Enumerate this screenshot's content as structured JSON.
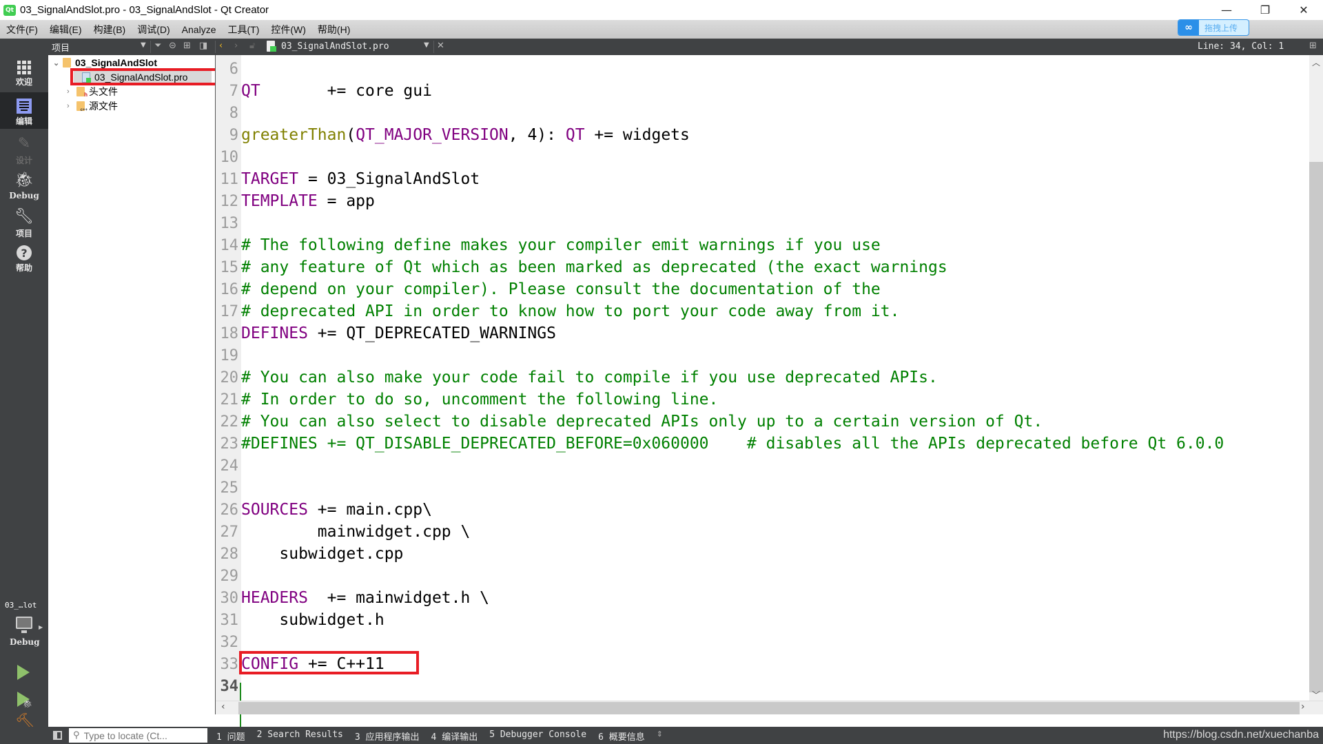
{
  "window": {
    "title": "03_SignalAndSlot.pro - 03_SignalAndSlot - Qt Creator",
    "app_icon_text": "Qt",
    "minimize": "—",
    "restore": "❐",
    "close": "✕"
  },
  "menu": [
    {
      "label": "文件(F)"
    },
    {
      "label": "编辑(E)"
    },
    {
      "label": "构建(B)"
    },
    {
      "label": "调试(D)"
    },
    {
      "label": "Analyze"
    },
    {
      "label": "工具(T)"
    },
    {
      "label": "控件(W)"
    },
    {
      "label": "帮助(H)"
    }
  ],
  "cloud_upload": {
    "label": "拖拽上传",
    "icon": "cloud-icon"
  },
  "toolbar": {
    "project_view": "项目",
    "open_file": "03_SignalAndSlot.pro",
    "line_col": "Line: 34, Col: 1"
  },
  "modes": [
    {
      "label": "欢迎",
      "icon": "grid-icon",
      "state": "normal"
    },
    {
      "label": "编辑",
      "icon": "edit-icon",
      "state": "active"
    },
    {
      "label": "设计",
      "icon": "pencil-icon",
      "state": "disabled"
    },
    {
      "label": "Debug",
      "icon": "bug-icon",
      "state": "normal"
    },
    {
      "label": "项目",
      "icon": "wrench-icon",
      "state": "normal"
    },
    {
      "label": "帮助",
      "icon": "help-icon",
      "state": "normal"
    }
  ],
  "kit": {
    "project": "03_…lot",
    "build": "Debug"
  },
  "tree": {
    "root": "03_SignalAndSlot",
    "items": [
      {
        "label": "03_SignalAndSlot.pro",
        "type": "pro",
        "selected": true
      },
      {
        "label": "头文件",
        "type": "folder",
        "badge": "h"
      },
      {
        "label": "源文件",
        "type": "folder",
        "badge": "c++"
      }
    ]
  },
  "editor": {
    "current_line": 34,
    "lines": [
      {
        "n": "6",
        "tokens": []
      },
      {
        "n": "7",
        "tokens": [
          {
            "t": "QT",
            "c": "kw"
          },
          {
            "t": "       += core gui",
            "c": "code"
          }
        ]
      },
      {
        "n": "8",
        "tokens": []
      },
      {
        "n": "9",
        "tokens": [
          {
            "t": "greaterThan",
            "c": "fn"
          },
          {
            "t": "(",
            "c": "code"
          },
          {
            "t": "QT_MAJOR_VERSION",
            "c": "kw"
          },
          {
            "t": ", 4): ",
            "c": "code"
          },
          {
            "t": "QT",
            "c": "kw"
          },
          {
            "t": " += widgets",
            "c": "code"
          }
        ]
      },
      {
        "n": "10",
        "tokens": []
      },
      {
        "n": "11",
        "tokens": [
          {
            "t": "TARGET",
            "c": "kw"
          },
          {
            "t": " = 03_SignalAndSlot",
            "c": "code"
          }
        ]
      },
      {
        "n": "12",
        "tokens": [
          {
            "t": "TEMPLATE",
            "c": "kw"
          },
          {
            "t": " = app",
            "c": "code"
          }
        ]
      },
      {
        "n": "13",
        "tokens": []
      },
      {
        "n": "14",
        "tokens": [
          {
            "t": "# The following define makes your compiler emit warnings if you use",
            "c": "cm"
          }
        ]
      },
      {
        "n": "15",
        "tokens": [
          {
            "t": "# any feature of Qt which as been marked as deprecated (the exact warnings",
            "c": "cm"
          }
        ]
      },
      {
        "n": "16",
        "tokens": [
          {
            "t": "# depend on your compiler). Please consult the documentation of the",
            "c": "cm"
          }
        ]
      },
      {
        "n": "17",
        "tokens": [
          {
            "t": "# deprecated API in order to know how to port your code away from it.",
            "c": "cm"
          }
        ]
      },
      {
        "n": "18",
        "tokens": [
          {
            "t": "DEFINES",
            "c": "kw"
          },
          {
            "t": " += QT_DEPRECATED_WARNINGS",
            "c": "code"
          }
        ]
      },
      {
        "n": "19",
        "tokens": []
      },
      {
        "n": "20",
        "tokens": [
          {
            "t": "# You can also make your code fail to compile if you use deprecated APIs.",
            "c": "cm"
          }
        ]
      },
      {
        "n": "21",
        "tokens": [
          {
            "t": "# In order to do so, uncomment the following line.",
            "c": "cm"
          }
        ]
      },
      {
        "n": "22",
        "tokens": [
          {
            "t": "# You can also select to disable deprecated APIs only up to a certain version of Qt.",
            "c": "cm"
          }
        ]
      },
      {
        "n": "23",
        "tokens": [
          {
            "t": "#DEFINES += QT_DISABLE_DEPRECATED_BEFORE=0x060000    # disables all the APIs deprecated before Qt 6.0.0",
            "c": "cm"
          }
        ]
      },
      {
        "n": "24",
        "tokens": []
      },
      {
        "n": "25",
        "tokens": []
      },
      {
        "n": "26",
        "tokens": [
          {
            "t": "SOURCES",
            "c": "kw"
          },
          {
            "t": " += main.cpp\\",
            "c": "code"
          }
        ]
      },
      {
        "n": "27",
        "tokens": [
          {
            "t": "        mainwidget.cpp \\",
            "c": "code"
          }
        ]
      },
      {
        "n": "28",
        "tokens": [
          {
            "t": "    subwidget.cpp",
            "c": "code"
          }
        ]
      },
      {
        "n": "29",
        "tokens": []
      },
      {
        "n": "30",
        "tokens": [
          {
            "t": "HEADERS",
            "c": "kw"
          },
          {
            "t": "  += mainwidget.h \\",
            "c": "code"
          }
        ]
      },
      {
        "n": "31",
        "tokens": [
          {
            "t": "    subwidget.h",
            "c": "code"
          }
        ]
      },
      {
        "n": "32",
        "tokens": []
      },
      {
        "n": "33",
        "tokens": [
          {
            "t": "CONFIG",
            "c": "kw"
          },
          {
            "t": " += C++11",
            "c": "code"
          }
        ]
      },
      {
        "n": "34",
        "tokens": []
      }
    ]
  },
  "locator": {
    "placeholder": "Type to locate (Ct..."
  },
  "output_tabs": [
    {
      "label": "1 问题"
    },
    {
      "label": "2 Search Results"
    },
    {
      "label": "3 应用程序输出"
    },
    {
      "label": "4 编译输出"
    },
    {
      "label": "5 Debugger Console"
    },
    {
      "label": "6 概要信息"
    }
  ],
  "watermark": "https://blog.csdn.net/xuechanba",
  "colors": {
    "keyword": "#800080",
    "function": "#808000",
    "comment": "#008000",
    "highlight_box": "#e81c24",
    "sidebar_bg": "#404244",
    "accent_edit": "#8e9bf2"
  }
}
